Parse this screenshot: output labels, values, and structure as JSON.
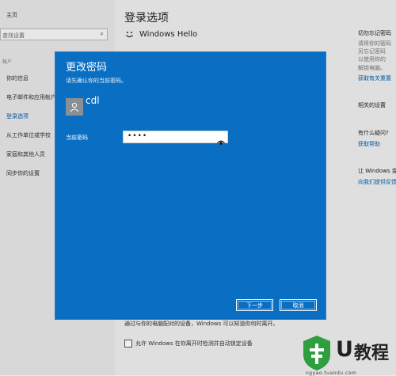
{
  "sidebar": {
    "home": "主页",
    "search_placeholder": "查找设置",
    "section": "帐户",
    "items": [
      {
        "label": "你的信息"
      },
      {
        "label": "电子邮件和应用帐户"
      },
      {
        "label": "登录选项"
      },
      {
        "label": "从工作单位或学校"
      },
      {
        "label": "家庭和其他人员"
      },
      {
        "label": "同步你的设置"
      }
    ]
  },
  "main": {
    "title": "登录选项",
    "hello": "Windows Hello",
    "bottom_text": "通过与你的电脑配对的设备，Windows 可以知道你何时离开。",
    "checkbox_label": "允许 Windows 在你离开时检测并自动锁定设备"
  },
  "right_panel": {
    "items": [
      {
        "text": "切勿忘记密码",
        "style": "h"
      },
      {
        "text": "请将你的密码",
        "style": "g"
      },
      {
        "text": "另忘记密码",
        "style": "g"
      },
      {
        "text": "以使用你的",
        "style": "g"
      },
      {
        "text": "解锁电脑。",
        "style": "g"
      },
      {
        "text": "获取有关重置",
        "style": "l"
      },
      {
        "text": "相关的设置",
        "style": "h"
      },
      {
        "text": "有什么疑问?",
        "style": "h"
      },
      {
        "text": "获取帮助",
        "style": "l"
      },
      {
        "text": "让 Windows 变",
        "style": "h"
      },
      {
        "text": "向我们提供反馈",
        "style": "l"
      }
    ]
  },
  "dialog": {
    "title": "更改密码",
    "subtitle": "请先确认你的当前密码。",
    "username": "cdl",
    "password_label": "当前密码",
    "password_value": "••••",
    "next_button": "下一步",
    "cancel_button": "取消"
  },
  "watermark": {
    "letter": "U",
    "text": "教程",
    "url": "ngyao.tuandu.com"
  },
  "colors": {
    "dialog_bg": "#0a6fc2",
    "link": "#0063b1",
    "watermark_green": "#2e9e3e"
  }
}
